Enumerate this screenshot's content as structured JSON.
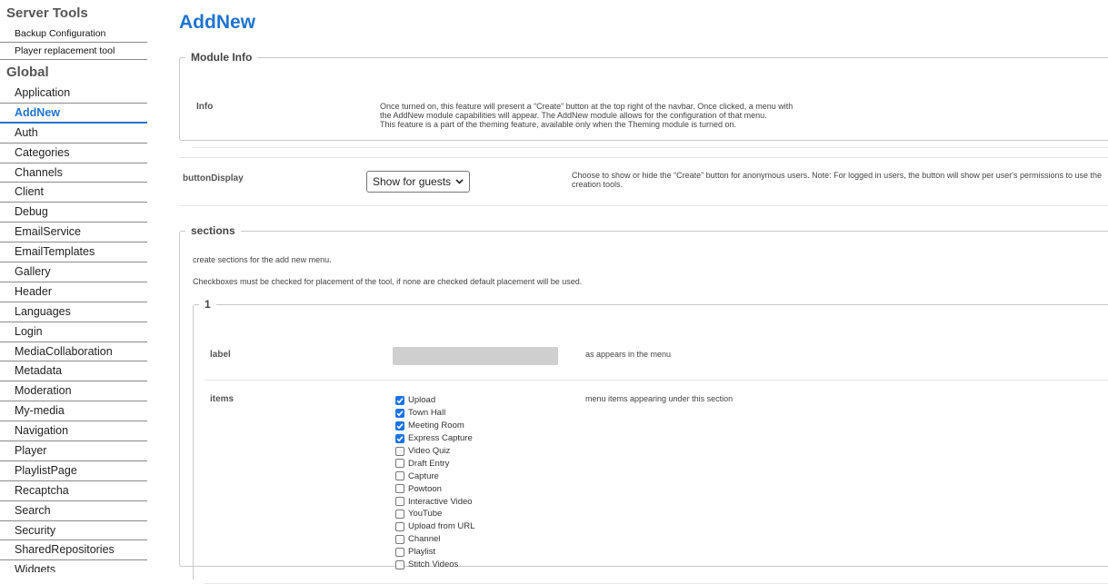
{
  "sidebar": {
    "server_tools_heading": "Server Tools",
    "server_tools": [
      "Backup Configuration",
      "Player replacement tool"
    ],
    "global_heading": "Global",
    "active_item": "AddNew",
    "items": [
      "Application",
      "AddNew",
      "Auth",
      "Categories",
      "Channels",
      "Client",
      "Debug",
      "EmailService",
      "EmailTemplates",
      "Gallery",
      "Header",
      "Languages",
      "Login",
      "MediaCollaboration",
      "Metadata",
      "Moderation",
      "My-media",
      "Navigation",
      "Player",
      "PlaylistPage",
      "Recaptcha",
      "Search",
      "Security",
      "SharedRepositories",
      "Widgets"
    ]
  },
  "page": {
    "title": "AddNew",
    "accent_color": "#1f74d2"
  },
  "module_info": {
    "legend": "Module Info",
    "label": "Info",
    "text_lines": [
      "Once turned on, this feature will present a “Create” button at the top right of the navbar. Once clicked, a menu with",
      "the AddNew module capabilities will appear. The AddNew module allows for the configuration of that menu.",
      "This feature is a part of the theming feature, available only when the Theming module is turned on."
    ]
  },
  "button_display": {
    "label": "buttonDisplay",
    "selected": "Show for guests",
    "description": "Choose to show or hide the “Create” button for anonymous users. Note: For logged in users, the button will show per user's permissions to use the creation tools."
  },
  "sections": {
    "legend": "sections",
    "intro": "create sections for the add new menu.",
    "note": "Checkboxes must be checked for placement of the tool, if none are checked default placement will be used.",
    "section_1": {
      "legend": "1",
      "label_field": "label",
      "label_desc": "as appears in the menu",
      "items_field": "items",
      "items_desc": "menu items appearing under this section",
      "items": [
        {
          "name": "Upload",
          "checked": true
        },
        {
          "name": "Town Hall",
          "checked": true
        },
        {
          "name": "Meeting Room",
          "checked": true
        },
        {
          "name": "Express Capture",
          "checked": true
        },
        {
          "name": "Video Quiz",
          "checked": false
        },
        {
          "name": "Draft Entry",
          "checked": false
        },
        {
          "name": "Capture",
          "checked": false
        },
        {
          "name": "Powtoon",
          "checked": false
        },
        {
          "name": "Interactive Video",
          "checked": false
        },
        {
          "name": "YouTube",
          "checked": false
        },
        {
          "name": "Upload from URL",
          "checked": false
        },
        {
          "name": "Channel",
          "checked": false
        },
        {
          "name": "Playlist",
          "checked": false
        },
        {
          "name": "Stitch Videos",
          "checked": false
        }
      ]
    }
  }
}
